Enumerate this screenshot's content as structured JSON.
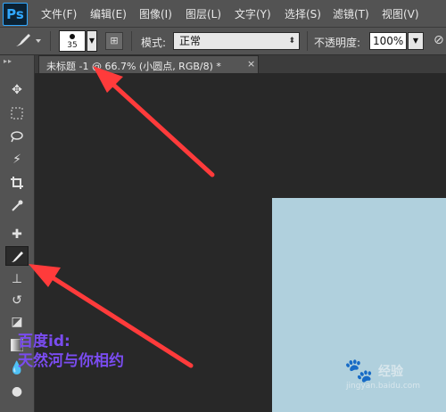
{
  "app": {
    "logo_text": "Ps"
  },
  "menu": {
    "items": [
      "文件(F)",
      "编辑(E)",
      "图像(I)",
      "图层(L)",
      "文字(Y)",
      "选择(S)",
      "滤镜(T)",
      "视图(V)"
    ]
  },
  "options": {
    "brush_size": "35",
    "mode_label": "模式:",
    "mode_value": "正常",
    "opacity_label": "不透明度:",
    "opacity_value": "100%"
  },
  "document": {
    "tab_title": "未标题 -1 @ 66.7% (小圆点, RGB/8) *",
    "close_glyph": "×"
  },
  "canvas": {
    "color": "#b0d0dd"
  },
  "watermark": {
    "line1": "百度id:",
    "line2": "天然河与你相约"
  },
  "baidu": {
    "brand": "经验",
    "url": "jingyan.baidu.com"
  },
  "annotations": {
    "arrow_color": "#ff3b3b"
  },
  "toolbar": {
    "tools": [
      {
        "name": "move-tool",
        "icon": "move-icon"
      },
      {
        "name": "marquee-tool",
        "icon": "rect-marquee-icon"
      },
      {
        "name": "lasso-tool",
        "icon": "lasso-icon"
      },
      {
        "name": "magic-wand-tool",
        "icon": "magic-wand-icon"
      },
      {
        "name": "crop-tool",
        "icon": "crop-icon"
      },
      {
        "name": "eyedropper-tool",
        "icon": "eyedropper-icon"
      },
      {
        "name": "healing-brush-tool",
        "icon": "bandage-icon"
      },
      {
        "name": "brush-tool",
        "icon": "brush-icon"
      },
      {
        "name": "clone-stamp-tool",
        "icon": "stamp-icon"
      },
      {
        "name": "history-brush-tool",
        "icon": "history-brush-icon"
      },
      {
        "name": "eraser-tool",
        "icon": "eraser-icon"
      },
      {
        "name": "gradient-tool",
        "icon": "gradient-icon"
      },
      {
        "name": "blur-tool",
        "icon": "drop-icon"
      },
      {
        "name": "dodge-tool",
        "icon": "dodge-icon"
      }
    ]
  }
}
